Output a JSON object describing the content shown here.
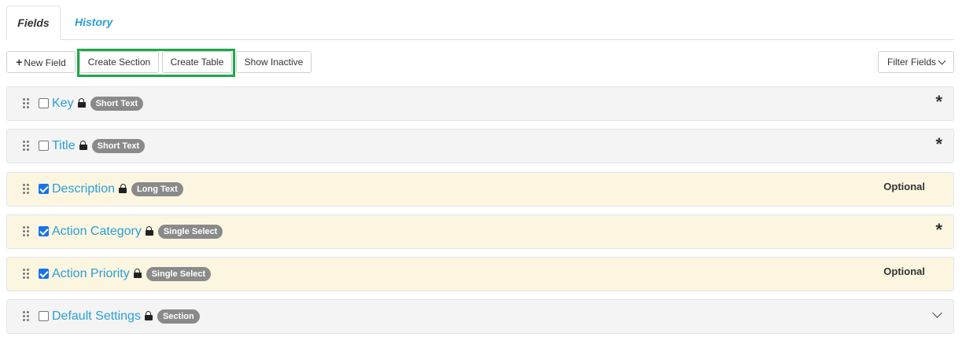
{
  "tabs": [
    {
      "label": "Fields",
      "active": true
    },
    {
      "label": "History",
      "active": false
    }
  ],
  "toolbar": {
    "new_field": "New Field",
    "create_section": "Create Section",
    "create_table": "Create Table",
    "show_inactive": "Show Inactive",
    "filter_fields": "Filter Fields"
  },
  "colors": {
    "link": "#2a9fd6",
    "highlight": "#1ea84a",
    "row_gray": "#f4f4f5",
    "row_yellow": "#fcf6e1",
    "badge": "#8a8a8a",
    "checkbox_checked": "#1a73e8"
  },
  "fields": [
    {
      "name": "Key",
      "type": "Short Text",
      "checked": false,
      "status": "*"
    },
    {
      "name": "Title",
      "type": "Short Text",
      "checked": false,
      "status": "*"
    },
    {
      "name": "Description",
      "type": "Long Text",
      "checked": true,
      "status": "Optional"
    },
    {
      "name": "Action Category",
      "type": "Single Select",
      "checked": true,
      "status": "*"
    },
    {
      "name": "Action Priority",
      "type": "Single Select",
      "checked": true,
      "status": "Optional"
    },
    {
      "name": "Default Settings",
      "type": "Section",
      "checked": false,
      "status": "chevron-down-icon"
    }
  ]
}
